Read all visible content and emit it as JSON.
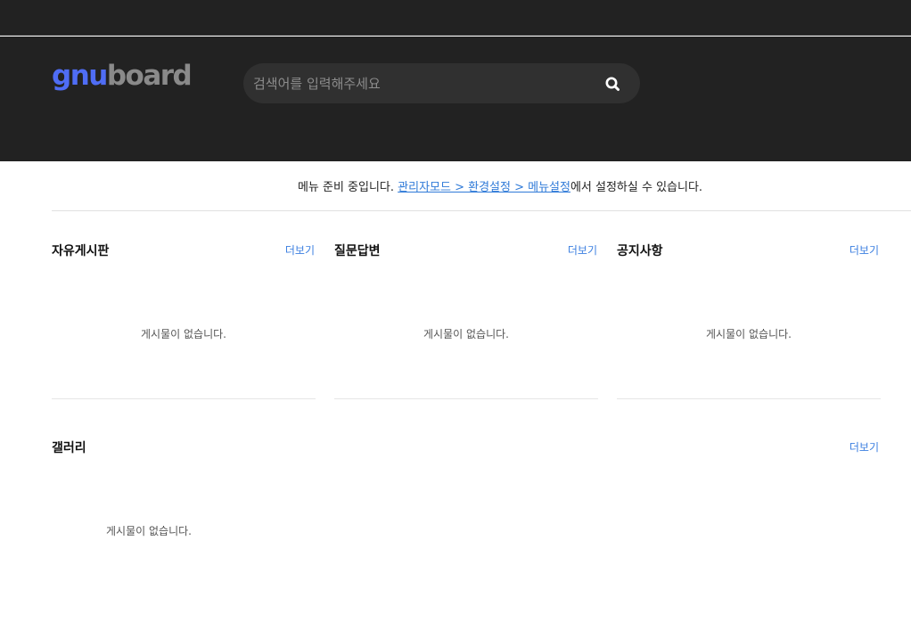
{
  "header": {
    "logo_part1": "gnu",
    "logo_part2": "board",
    "search_placeholder": "검색어를 입력해주세요",
    "search_icon": "magnifier-icon"
  },
  "notice": {
    "text_before": "메뉴 준비 중입니다. ",
    "link_text": "관리자모드 > 환경설정 > 메뉴설정",
    "text_after": "에서 설정하실 수 있습니다."
  },
  "boards": [
    {
      "title": "자유게시판",
      "more": "더보기",
      "empty": "게시물이 없습니다."
    },
    {
      "title": "질문답변",
      "more": "더보기",
      "empty": "게시물이 없습니다."
    },
    {
      "title": "공지사항",
      "more": "더보기",
      "empty": "게시물이 없습니다."
    }
  ],
  "gallery": {
    "title": "갤러리",
    "more": "더보기",
    "empty": "게시물이 없습니다."
  },
  "colors": {
    "header_bg": "#222222",
    "logo_accent": "#4f6df5",
    "logo_gray": "#8a8a8a",
    "link": "#2f7ad8",
    "more_link": "#3c7fe0"
  }
}
